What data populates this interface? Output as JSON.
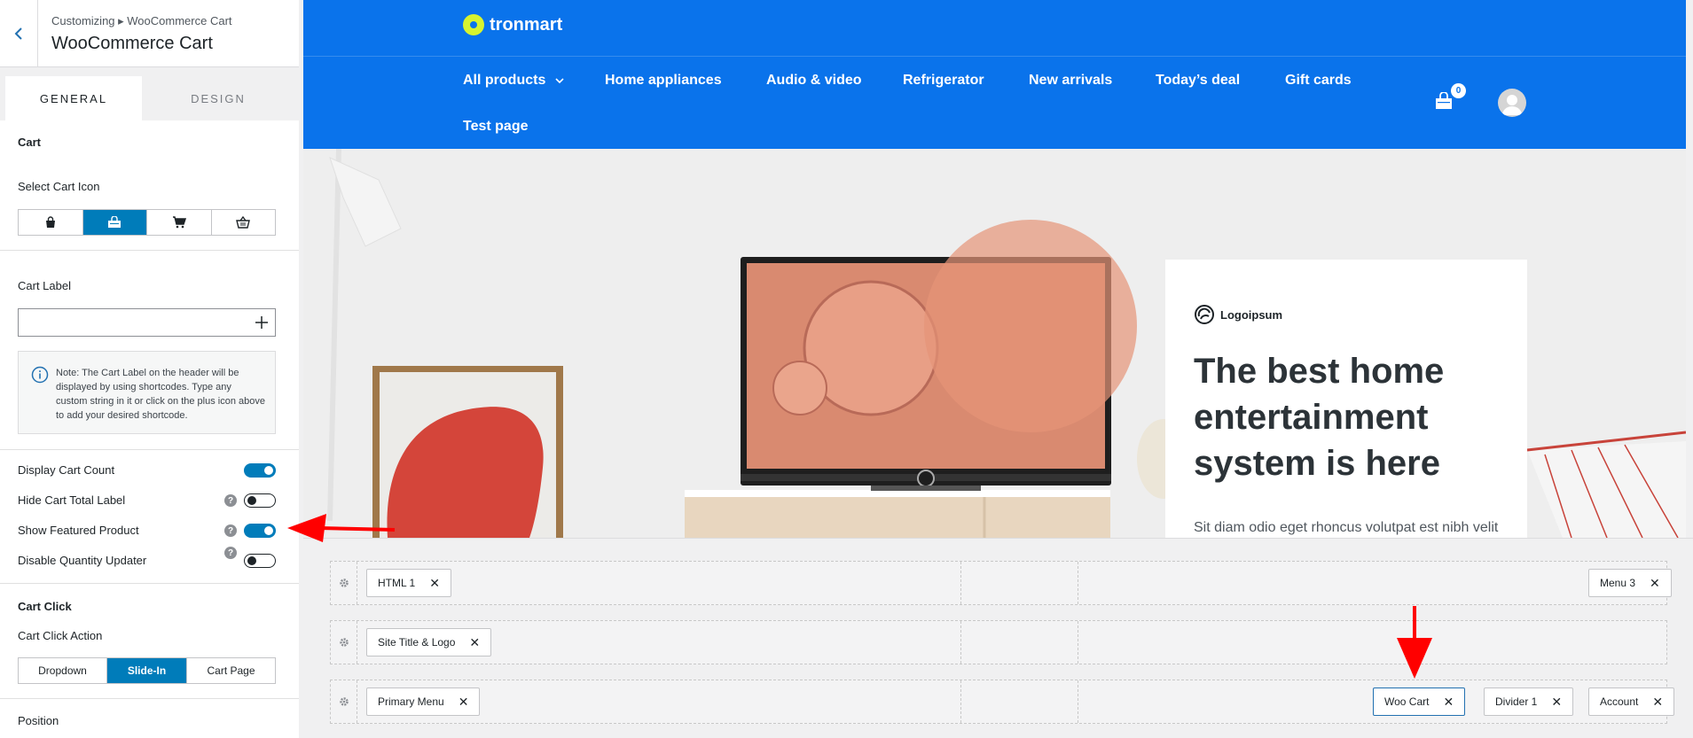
{
  "sidebar": {
    "breadcrumb": "Customizing ▸ WooCommerce Cart",
    "title": "WooCommerce Cart",
    "tabs": {
      "general": "GENERAL",
      "design": "DESIGN"
    },
    "cart_section": "Cart",
    "select_cart_icon": "Select Cart Icon",
    "cart_label": "Cart Label",
    "cart_label_value": "",
    "note": "Note: The Cart Label on the header will be displayed by using shortcodes. Type any custom string in it or click on the plus icon above to add your desired shortcode.",
    "toggles": {
      "display_count": {
        "label": "Display Cart Count",
        "on": true
      },
      "hide_total": {
        "label": "Hide Cart Total Label",
        "on": false
      },
      "featured": {
        "label": "Show Featured Product",
        "on": true
      },
      "disable_qty": {
        "label": "Disable Quantity Updater",
        "on": false
      }
    },
    "help_glyph": "?",
    "cart_click_section": "Cart Click",
    "cart_click_action": "Cart Click Action",
    "actions": {
      "dropdown": "Dropdown",
      "slidein": "Slide-In",
      "cartpage": "Cart Page"
    },
    "position": "Position"
  },
  "preview": {
    "brand": "tronmart",
    "nav": {
      "all_products": "All products",
      "home_appliances": "Home appliances",
      "audio_video": "Audio & video",
      "refrigerator": "Refrigerator",
      "new_arrivals": "New arrivals",
      "todays_deal": "Today’s deal",
      "gift_cards": "Gift cards",
      "test_page": "Test page"
    },
    "cart_count": "0",
    "hero": {
      "logo_text": "Logoipsum",
      "heading": "The best home entertainment system is here",
      "text": "Sit diam odio eget rhoncus volutpat est nibh velit posuere egestas"
    }
  },
  "builder": {
    "row1": {
      "html1": "HTML 1",
      "menu3": "Menu 3"
    },
    "row2": {
      "site_title": "Site Title & Logo"
    },
    "row3": {
      "primary_menu": "Primary Menu",
      "woo_cart": "Woo Cart",
      "divider1": "Divider 1",
      "account": "Account"
    },
    "remove_glyph": "✕"
  },
  "colors": {
    "accent": "#007cba",
    "header_blue": "#0a73eb",
    "logo_yellow": "#d7f32f",
    "arrow_red": "#ff0000"
  }
}
